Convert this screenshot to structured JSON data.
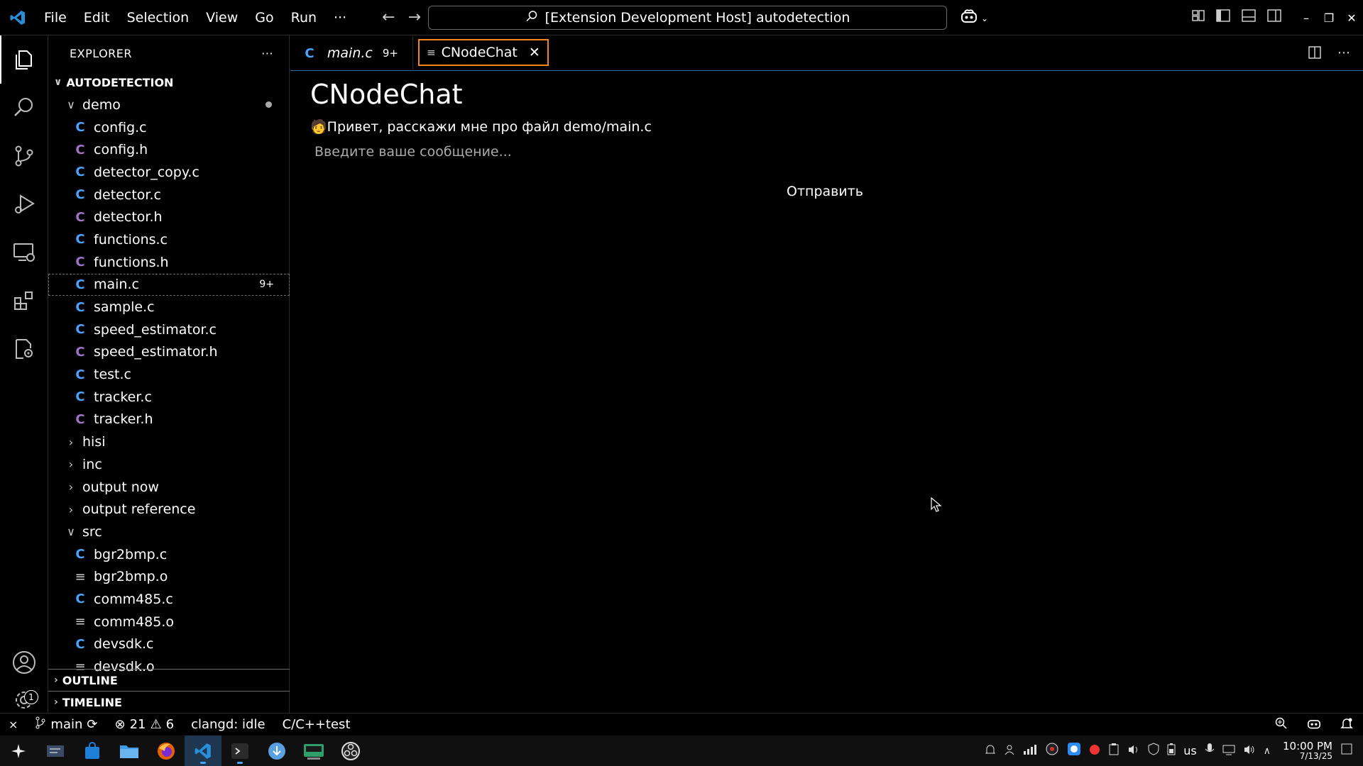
{
  "titlebar": {
    "menu": [
      "File",
      "Edit",
      "Selection",
      "View",
      "Go",
      "Run",
      "···"
    ],
    "search_text": "[Extension Development Host] autodetection"
  },
  "sidebar": {
    "header": "EXPLORER",
    "header_more": "···",
    "root": "AUTODETECTION",
    "tree": [
      {
        "label": "demo",
        "type": "folder-open",
        "depth": 1,
        "dot": true
      },
      {
        "label": "config.c",
        "type": "c",
        "depth": 2
      },
      {
        "label": "config.h",
        "type": "h",
        "depth": 2
      },
      {
        "label": "detector_copy.c",
        "type": "c",
        "depth": 2
      },
      {
        "label": "detector.c",
        "type": "c",
        "depth": 2
      },
      {
        "label": "detector.h",
        "type": "h",
        "depth": 2
      },
      {
        "label": "functions.c",
        "type": "c",
        "depth": 2
      },
      {
        "label": "functions.h",
        "type": "h",
        "depth": 2
      },
      {
        "label": "main.c",
        "type": "c",
        "depth": 2,
        "badge": "9+",
        "selected": true
      },
      {
        "label": "sample.c",
        "type": "c",
        "depth": 2
      },
      {
        "label": "speed_estimator.c",
        "type": "c",
        "depth": 2
      },
      {
        "label": "speed_estimator.h",
        "type": "h",
        "depth": 2
      },
      {
        "label": "test.c",
        "type": "c",
        "depth": 2
      },
      {
        "label": "tracker.c",
        "type": "c",
        "depth": 2
      },
      {
        "label": "tracker.h",
        "type": "h",
        "depth": 2
      },
      {
        "label": "hisi",
        "type": "folder",
        "depth": 1
      },
      {
        "label": "inc",
        "type": "folder",
        "depth": 1
      },
      {
        "label": "output now",
        "type": "folder",
        "depth": 1
      },
      {
        "label": "output reference",
        "type": "folder",
        "depth": 1
      },
      {
        "label": "src",
        "type": "folder-open",
        "depth": 1
      },
      {
        "label": "bgr2bmp.c",
        "type": "c",
        "depth": 2
      },
      {
        "label": "bgr2bmp.o",
        "type": "o",
        "depth": 2
      },
      {
        "label": "comm485.c",
        "type": "c",
        "depth": 2
      },
      {
        "label": "comm485.o",
        "type": "o",
        "depth": 2
      },
      {
        "label": "devsdk.c",
        "type": "c",
        "depth": 2
      },
      {
        "label": "devsdk.o",
        "type": "o",
        "depth": 2
      }
    ],
    "outline": "OUTLINE",
    "timeline": "TIMELINE"
  },
  "tabs": [
    {
      "label": "main.c",
      "count": "9+",
      "active": false
    },
    {
      "label": "CNodeChat",
      "active": true
    }
  ],
  "chat": {
    "title": "CNodeChat",
    "message_emoji": "🧑",
    "message": "Привет, расскажи мне про файл demo/main.c",
    "input_placeholder": "Введите ваше сообщение...",
    "send_label": "Отправить"
  },
  "statusbar": {
    "branch": "main",
    "errors": "21",
    "warnings": "6",
    "clangd": "clangd: idle",
    "config": "C/C++test"
  },
  "taskbar": {
    "lang": "us",
    "time": "10:00 PM",
    "date": "7/13/25"
  },
  "activity_badge": "1"
}
